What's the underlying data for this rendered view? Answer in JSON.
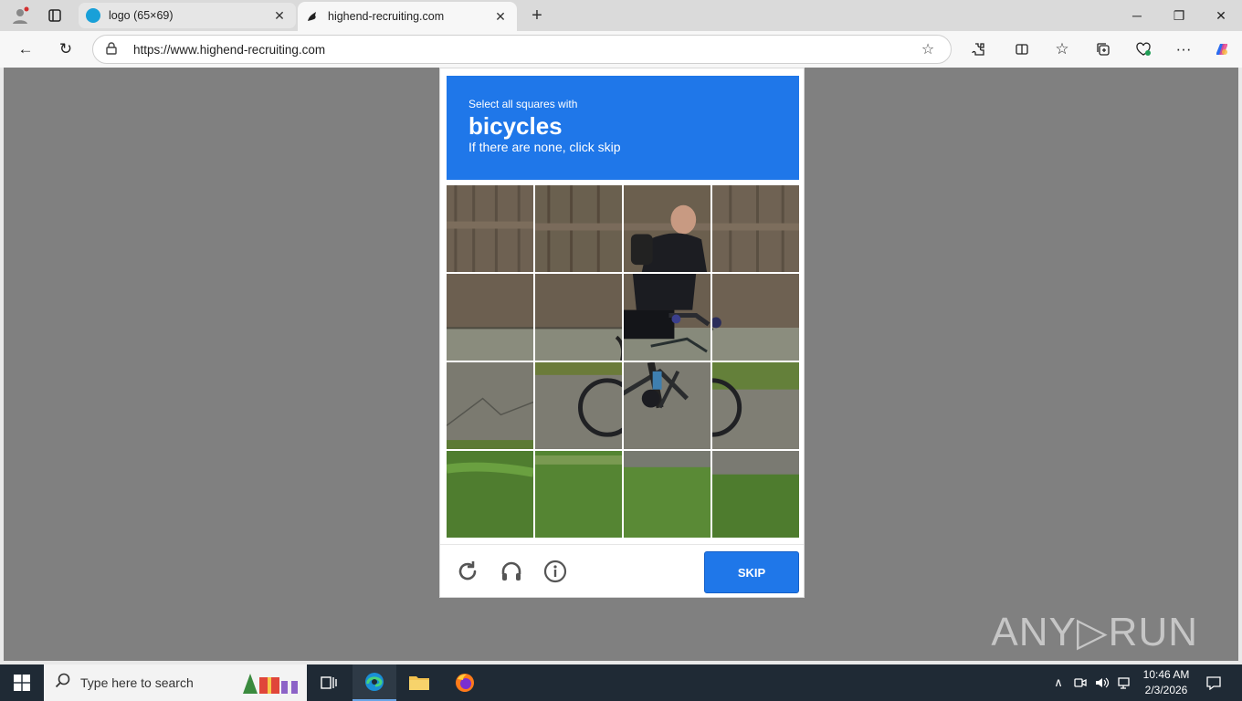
{
  "browser": {
    "tabs": [
      {
        "title": "logo (65×69)",
        "active": false
      },
      {
        "title": "highend-recruiting.com",
        "active": true
      }
    ],
    "url": "https://www.highend-recruiting.com"
  },
  "captcha": {
    "instruction": "Select all squares with",
    "target": "bicycles",
    "hint": "If there are none, click skip",
    "skip_label": "SKIP",
    "accent_color": "#1f77e9"
  },
  "watermark": "ANY▷RUN",
  "taskbar": {
    "search_placeholder": "Type here to search",
    "time": "10:46 AM",
    "date": "2/3/2026"
  }
}
